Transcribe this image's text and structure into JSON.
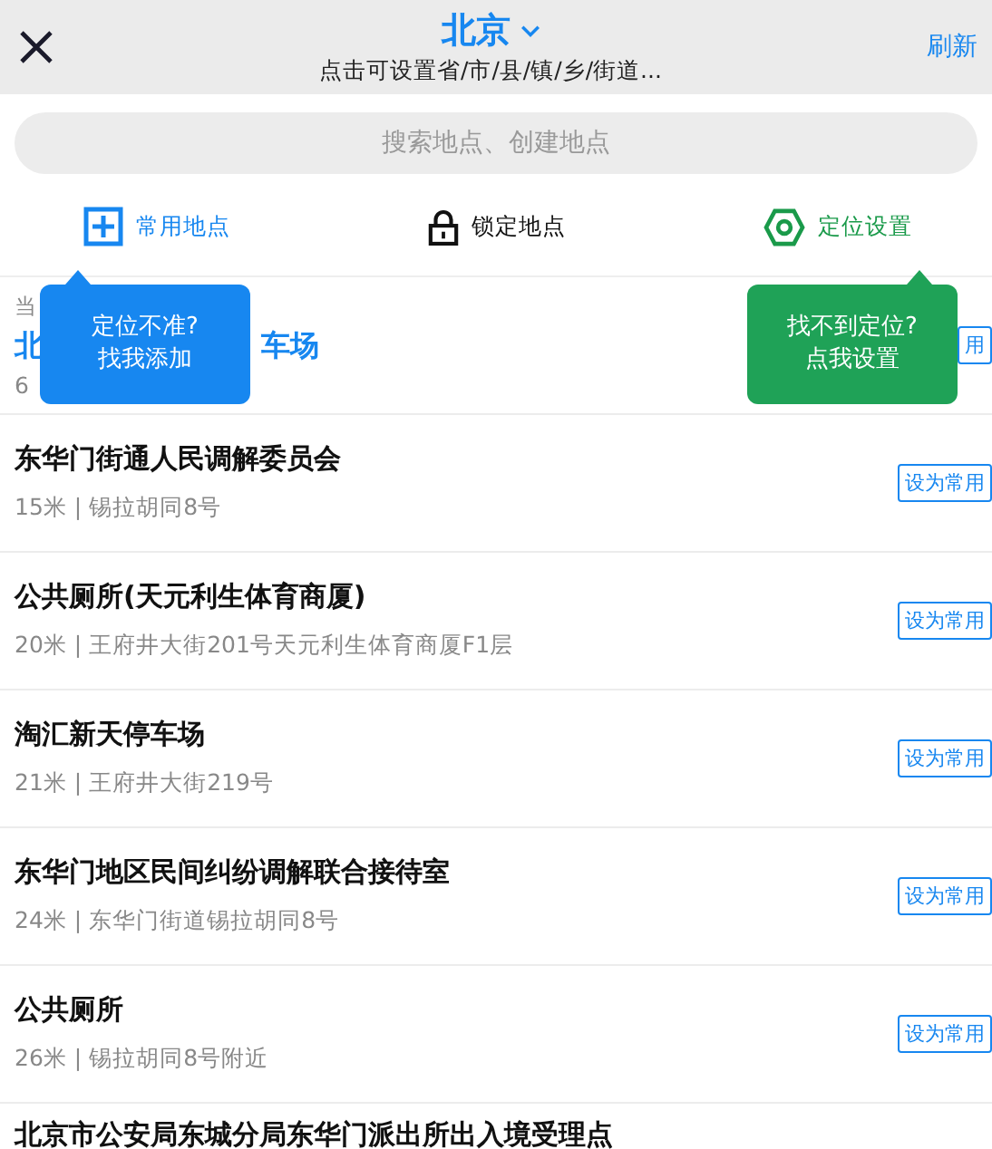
{
  "header": {
    "city": "北京",
    "subtitle": "点击可设置省/市/县/镇/乡/街道...",
    "refresh": "刷新"
  },
  "search": {
    "placeholder": "搜索地点、创建地点"
  },
  "actions": [
    {
      "kind": "add",
      "label": "常用地点"
    },
    {
      "kind": "lock",
      "label": "锁定地点"
    },
    {
      "kind": "settings",
      "label": "定位设置"
    }
  ],
  "current": {
    "label": "当",
    "title_start": "北",
    "title_end": "车场",
    "distance": "6",
    "button": "用"
  },
  "places": [
    {
      "name": "东华门街通人民调解委员会",
      "detail": "15米 | 锡拉胡同8号",
      "button": "设为常用"
    },
    {
      "name": "公共厕所(天元利生体育商厦)",
      "detail": "20米 | 王府井大街201号天元利生体育商厦F1层",
      "button": "设为常用"
    },
    {
      "name": "淘汇新天停车场",
      "detail": "21米 | 王府井大街219号",
      "button": "设为常用"
    },
    {
      "name": "东华门地区民间纠纷调解联合接待室",
      "detail": "24米 | 东华门街道锡拉胡同8号",
      "button": "设为常用"
    },
    {
      "name": "公共厕所",
      "detail": "26米 | 锡拉胡同8号附近",
      "button": "设为常用"
    },
    {
      "name": "北京市公安局东城分局东华门派出所出入境受理点"
    }
  ],
  "tips": [
    {
      "kind": "blue",
      "line1": "定位不准?",
      "line2": "找我添加"
    },
    {
      "kind": "green",
      "line1": "找不到定位?",
      "line2": "点我设置"
    }
  ]
}
